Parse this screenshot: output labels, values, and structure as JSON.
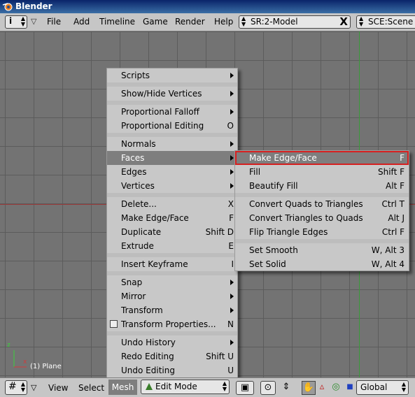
{
  "window": {
    "title": "Blender"
  },
  "topbar": {
    "menus": [
      "File",
      "Add",
      "Timeline",
      "Game",
      "Render",
      "Help"
    ],
    "screen_field": "SR:2-Model",
    "scene_field": "SCE:Scene",
    "close_glyph": "X"
  },
  "viewport": {
    "object_label": "(1) Plane",
    "axis_x": "x",
    "axis_z": "z"
  },
  "mesh_menu": {
    "items": [
      {
        "label": "Scripts",
        "key": "",
        "submenu": true
      },
      {
        "label": "Show/Hide Vertices",
        "key": "",
        "submenu": true
      },
      {
        "label": "Proportional Falloff",
        "key": "",
        "submenu": true
      },
      {
        "label": "Proportional Editing",
        "key": "O",
        "submenu": false
      },
      {
        "label": "Normals",
        "key": "",
        "submenu": true
      },
      {
        "label": "Faces",
        "key": "",
        "submenu": true
      },
      {
        "label": "Edges",
        "key": "",
        "submenu": true
      },
      {
        "label": "Vertices",
        "key": "",
        "submenu": true
      },
      {
        "label": "Delete...",
        "key": "X",
        "submenu": false
      },
      {
        "label": "Make Edge/Face",
        "key": "F",
        "submenu": false
      },
      {
        "label": "Duplicate",
        "key": "Shift D",
        "submenu": false
      },
      {
        "label": "Extrude",
        "key": "E",
        "submenu": false
      },
      {
        "label": "Insert Keyframe",
        "key": "I",
        "submenu": false
      },
      {
        "label": "Snap",
        "key": "",
        "submenu": true
      },
      {
        "label": "Mirror",
        "key": "",
        "submenu": true
      },
      {
        "label": "Transform",
        "key": "",
        "submenu": true
      },
      {
        "label": "Transform Properties...",
        "key": "N",
        "submenu": false
      },
      {
        "label": "Undo History",
        "key": "",
        "submenu": true
      },
      {
        "label": "Redo Editing",
        "key": "Shift U",
        "submenu": false
      },
      {
        "label": "Undo Editing",
        "key": "U",
        "submenu": false
      }
    ]
  },
  "faces_menu": {
    "items": [
      {
        "label": "Make Edge/Face",
        "key": "F"
      },
      {
        "label": "Fill",
        "key": "Shift F"
      },
      {
        "label": "Beautify Fill",
        "key": "Alt F"
      },
      {
        "label": "Convert Quads to Triangles",
        "key": "Ctrl T"
      },
      {
        "label": "Convert Triangles to Quads",
        "key": "Alt J"
      },
      {
        "label": "Flip Triangle Edges",
        "key": "Ctrl F"
      },
      {
        "label": "Set Smooth",
        "key": "W, Alt 3"
      },
      {
        "label": "Set Solid",
        "key": "W, Alt 4"
      }
    ]
  },
  "bottombar": {
    "menus": [
      "View",
      "Select",
      "Mesh"
    ],
    "mode": "Edit Mode",
    "orientation": "Global"
  },
  "colors": {
    "highlight": "#7e7e7e",
    "red_outline": "#d62020",
    "menu_bg": "#c8c8c8"
  }
}
